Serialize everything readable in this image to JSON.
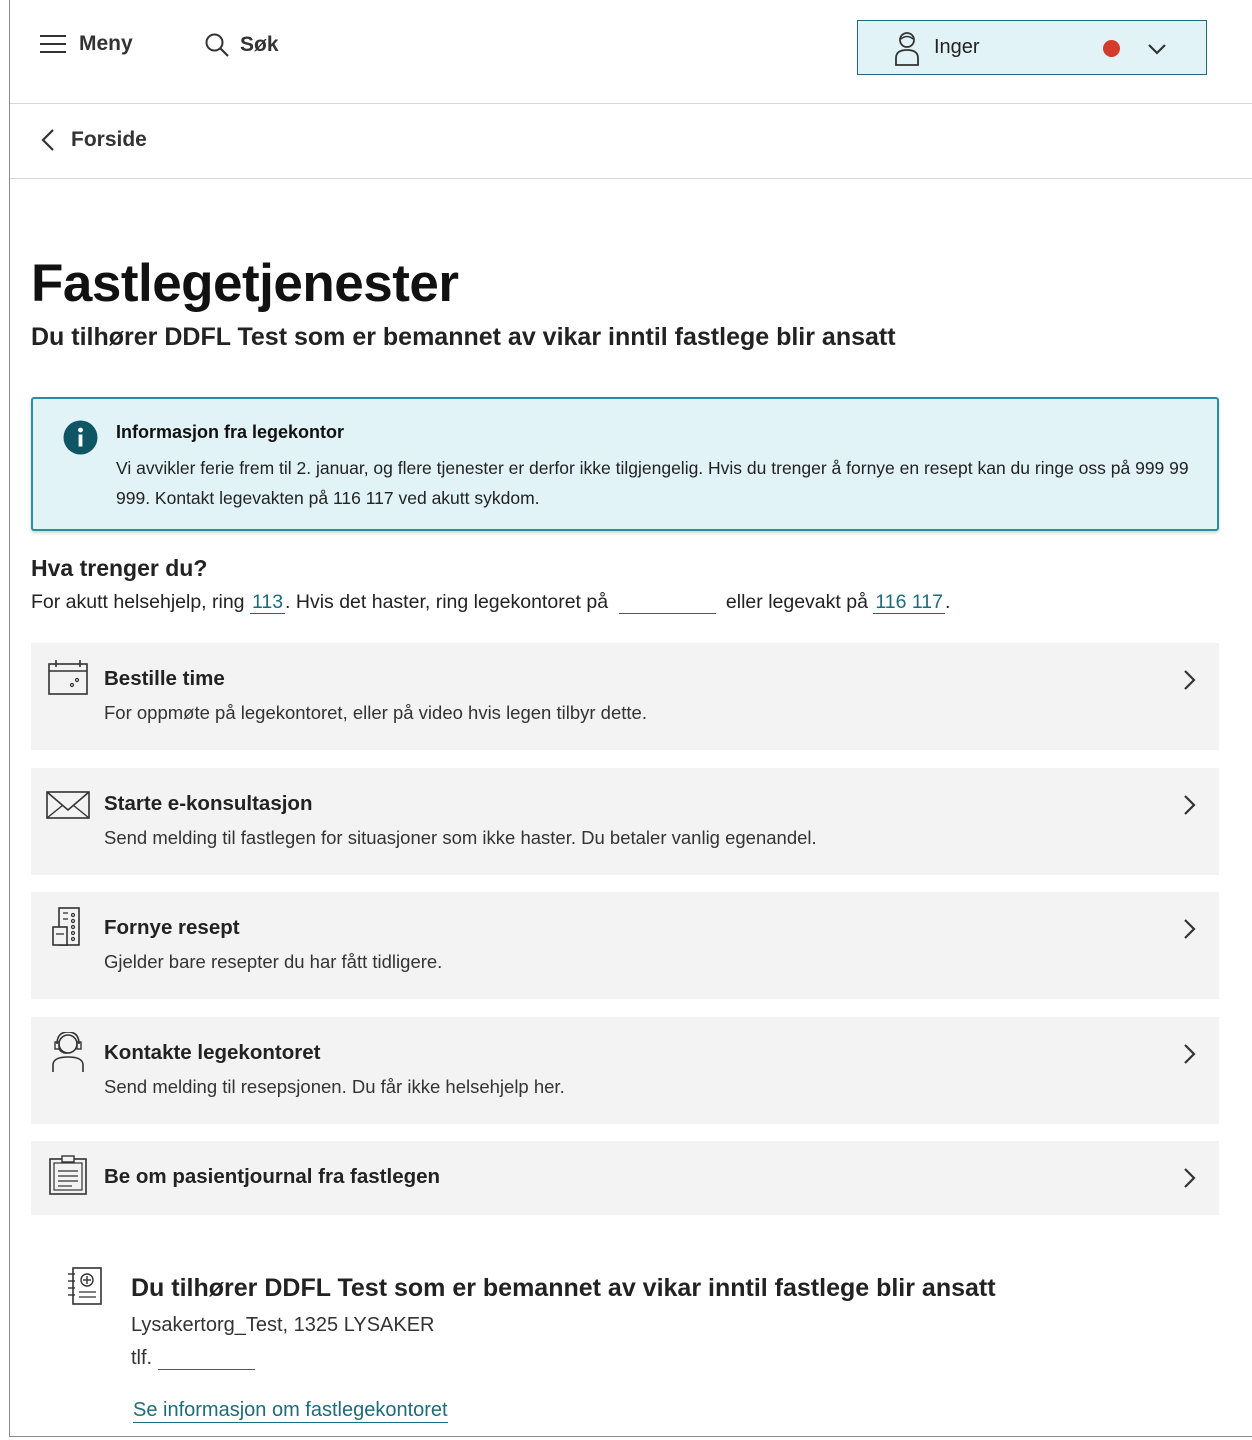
{
  "header": {
    "menu_label": "Meny",
    "search_label": "Søk",
    "user_name": "Inger",
    "notification_color": "#d33c2a"
  },
  "breadcrumb": {
    "back_label": "Forside"
  },
  "page": {
    "title": "Fastlegetjenester",
    "subtitle": "Du tilhører DDFL Test som er bemannet av vikar inntil fastlege blir ansatt"
  },
  "info": {
    "title": "Informasjon fra legekontor",
    "text": "Vi avvikler ferie frem til 2. januar, og flere tjenester er derfor ikke tilgjengelig. Hvis du trenger å fornye en resept kan du ringe oss på 999 99 999. Kontakt legevakten på 116 117 ved akutt sykdom."
  },
  "need": {
    "title": "Hva trenger du?",
    "prefix": "For akutt helsehjelp, ring",
    "emergency_number": "113",
    "middle": ". Hvis det haster, ring legekontoret på",
    "middle2": "eller legevakt på",
    "legevakt_number": "116 117",
    "suffix": "."
  },
  "services": [
    {
      "title": "Bestille time",
      "description": "For oppmøte på legekontoret, eller på video hvis legen tilbyr dette.",
      "icon": "calendar-icon"
    },
    {
      "title": "Starte e-konsultasjon",
      "description": "Send melding til fastlegen for situasjoner som ikke haster. Du betaler vanlig egenandel.",
      "icon": "envelope-icon"
    },
    {
      "title": "Fornye resept",
      "description": "Gjelder bare resepter du har fått tidligere.",
      "icon": "prescription-icon"
    },
    {
      "title": "Kontakte legekontoret",
      "description": "Send melding til resepsjonen. Du får ikke helsehjelp her.",
      "icon": "headset-icon"
    },
    {
      "title": "Be om pasientjournal fra fastlegen",
      "description": "",
      "icon": "clipboard-icon"
    }
  ],
  "office": {
    "title": "Du tilhører DDFL Test som er bemannet av vikar inntil fastlege blir ansatt",
    "address": "Lysakertorg_Test, 1325 LYSAKER",
    "phone_label": "tlf.",
    "link": "Se informasjon om fastlegekontoret"
  }
}
